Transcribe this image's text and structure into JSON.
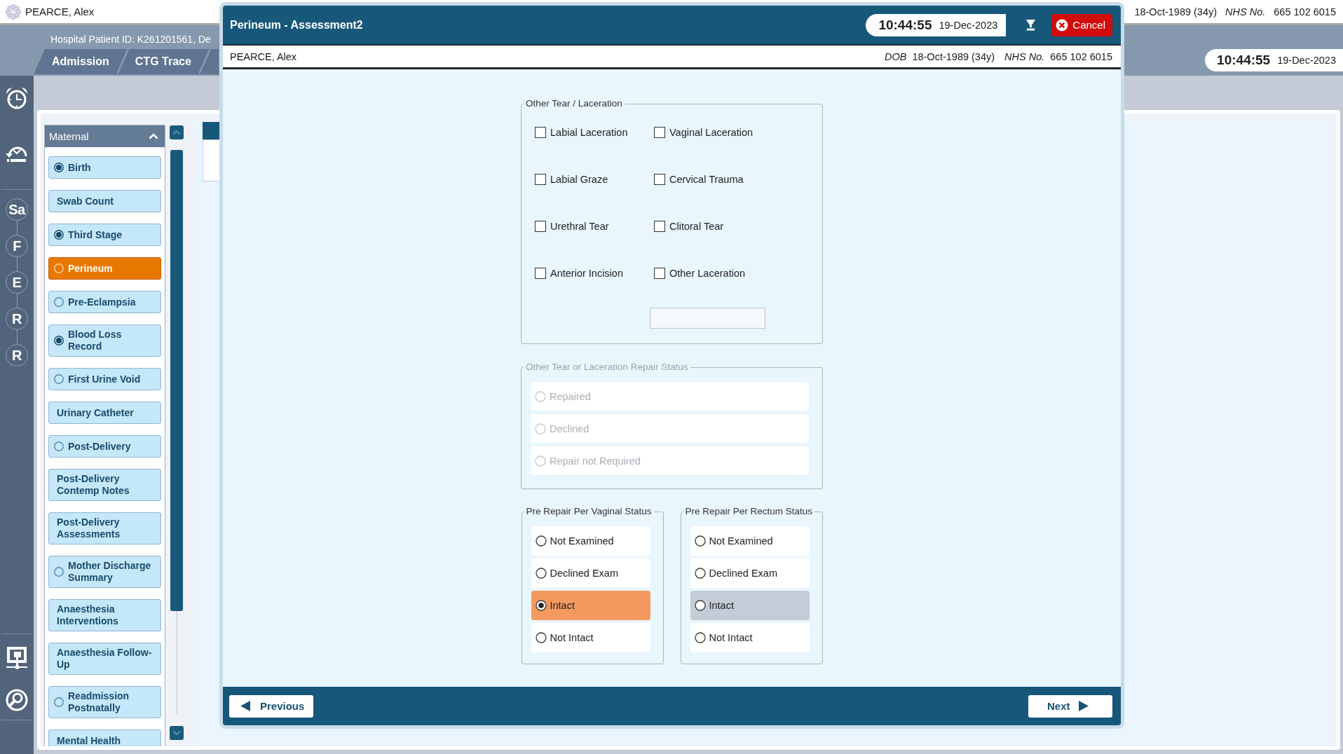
{
  "app_header": {
    "patient_name": "PEARCE, Alex",
    "dob": "18-Oct-1989 (34y)",
    "nhs_label": "NHS No.",
    "nhs_number": "665 102 6015"
  },
  "banner": {
    "patient_id": "Hospital Patient ID: K261201561, De",
    "tabs": [
      {
        "label": "Admission",
        "selected": false
      },
      {
        "label": "CTG Trace",
        "selected": false
      },
      {
        "selected": false
      }
    ],
    "clock": {
      "time": "10:44:55",
      "date": "19-Dec-2023"
    }
  },
  "rail": {
    "steps": [
      "Sa",
      "F",
      "E",
      "R",
      "R"
    ]
  },
  "sidebar": {
    "title": "Maternal",
    "items": [
      {
        "label": "Birth",
        "kind": "radio",
        "filled": true,
        "selected": false
      },
      {
        "label": "Swab Count",
        "kind": "plain",
        "selected": false
      },
      {
        "label": "Third Stage",
        "kind": "radio",
        "filled": true,
        "selected": false
      },
      {
        "label": "Perineum",
        "kind": "radio",
        "filled": false,
        "selected": true
      },
      {
        "label": "Pre-Eclampsia",
        "kind": "radio",
        "filled": false,
        "selected": false
      },
      {
        "label": "Blood Loss Record",
        "kind": "radio",
        "filled": true,
        "selected": false
      },
      {
        "label": "First Urine Void",
        "kind": "radio",
        "filled": false,
        "selected": false
      },
      {
        "label": "Urinary Catheter",
        "kind": "plain",
        "selected": false
      },
      {
        "label": "Post-Delivery",
        "kind": "radio",
        "filled": false,
        "selected": false
      },
      {
        "label": "Post-Delivery Contemp Notes",
        "kind": "plain",
        "selected": false
      },
      {
        "label": "Post-Delivery Assessments",
        "kind": "plain",
        "selected": false
      },
      {
        "label": "Mother Discharge Summary",
        "kind": "radio",
        "filled": false,
        "selected": false
      },
      {
        "label": "Anaesthesia Interventions",
        "kind": "plain",
        "selected": false
      },
      {
        "label": "Anaesthesia Follow-Up",
        "kind": "plain",
        "selected": false
      },
      {
        "label": "Readmission Postnatally",
        "kind": "radio",
        "filled": false,
        "selected": false
      },
      {
        "label": "Mental Health",
        "kind": "plain",
        "selected": false
      }
    ]
  },
  "dialog": {
    "title": "Perineum - Assessment2",
    "clock": {
      "time": "10:44:55",
      "date": "19-Dec-2023"
    },
    "cancel_label": "Cancel",
    "patient": {
      "name": "PEARCE, Alex",
      "dob_label": "DOB",
      "dob": "18-Oct-1989 (34y)",
      "nhs_label": "NHS No.",
      "nhs_number": "665 102 6015"
    },
    "tear_group": {
      "legend": "Other Tear / Laceration",
      "items": [
        {
          "label": "Labial Laceration",
          "checked": false
        },
        {
          "label": "Vaginal Laceration",
          "checked": false
        },
        {
          "label": "Labial Graze",
          "checked": false
        },
        {
          "label": "Cervical Trauma",
          "checked": false
        },
        {
          "label": "Urethral Tear",
          "checked": false
        },
        {
          "label": "Clitoral Tear",
          "checked": false
        },
        {
          "label": "Anterior Incision",
          "checked": false
        },
        {
          "label": "Other Laceration",
          "checked": false
        }
      ]
    },
    "repair_group": {
      "legend": "Other Tear or Laceration Repair Status",
      "disabled": true,
      "options": [
        {
          "label": "Repaired",
          "selected": false
        },
        {
          "label": "Declined",
          "selected": false
        },
        {
          "label": "Repair not Required",
          "selected": false
        }
      ]
    },
    "status_groups": [
      {
        "legend": "Pre Repair Per Vaginal Status",
        "options": [
          {
            "label": "Not Examined",
            "selected": false,
            "highlighted": false
          },
          {
            "label": "Declined Exam",
            "selected": false,
            "highlighted": false
          },
          {
            "label": "Intact",
            "selected": true,
            "highlighted": false
          },
          {
            "label": "Not Intact",
            "selected": false,
            "highlighted": false
          }
        ]
      },
      {
        "legend": "Pre Repair Per Rectum Status",
        "options": [
          {
            "label": "Not Examined",
            "selected": false,
            "highlighted": false
          },
          {
            "label": "Declined Exam",
            "selected": false,
            "highlighted": false
          },
          {
            "label": "Intact",
            "selected": false,
            "highlighted": true
          },
          {
            "label": "Not Intact",
            "selected": false,
            "highlighted": false
          }
        ]
      }
    ],
    "footer": {
      "previous_label": "Previous",
      "next_label": "Next"
    }
  }
}
